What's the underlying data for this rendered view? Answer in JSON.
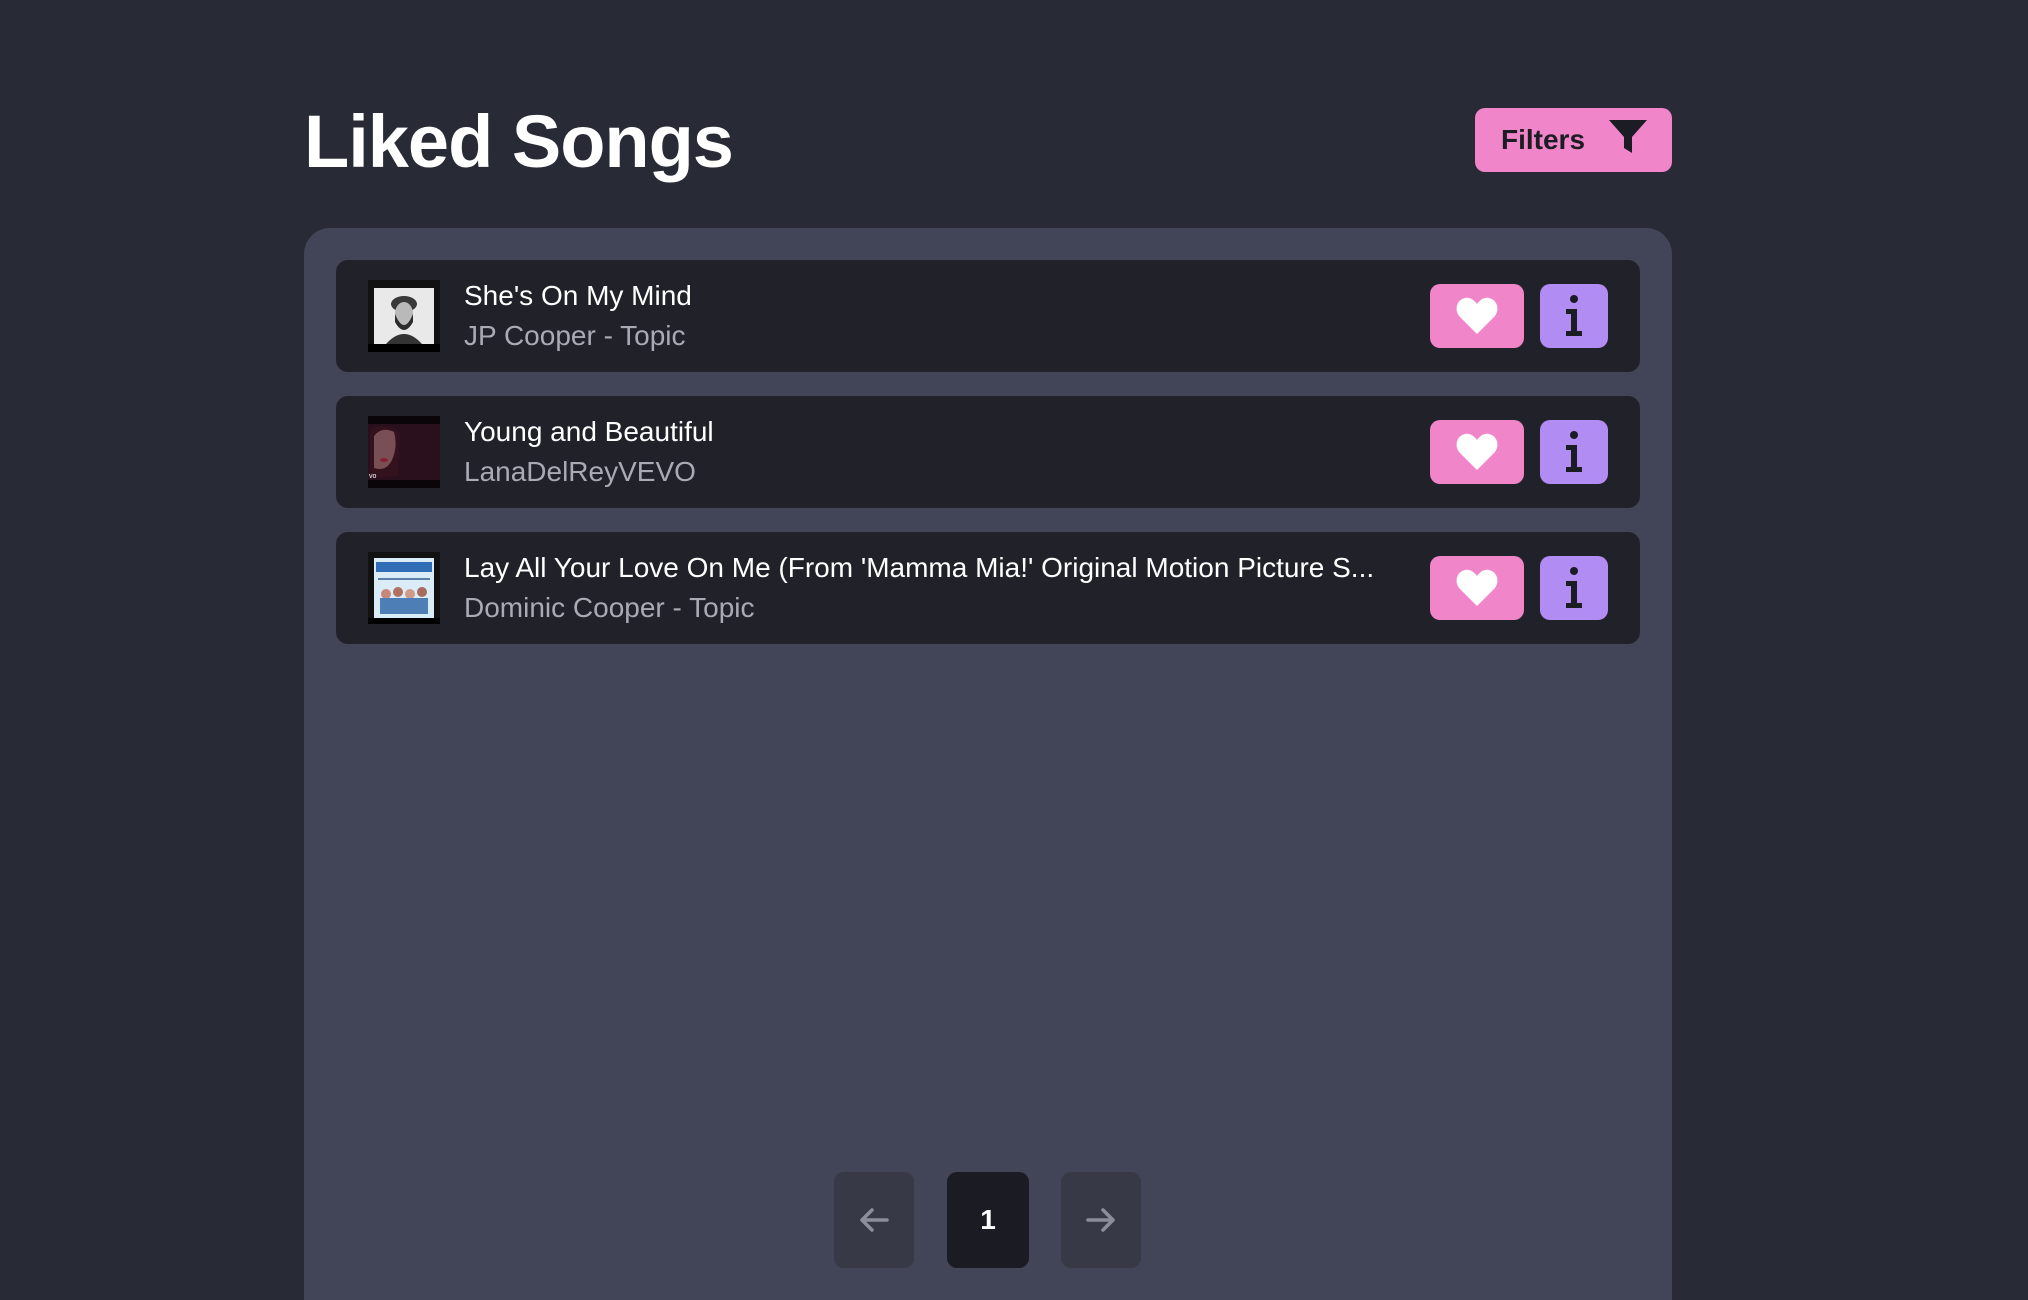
{
  "header": {
    "title": "Liked Songs",
    "filters_label": "Filters"
  },
  "songs": [
    {
      "title": "She's On My Mind",
      "artist": "JP Cooper - Topic",
      "thumbnail": "jp-cooper-portrait"
    },
    {
      "title": "Young and Beautiful",
      "artist": "LanaDelReyVEVO",
      "thumbnail": "lana-del-rey-portrait"
    },
    {
      "title": "Lay All Your Love On Me (From 'Mamma Mia!' Original Motion Picture S...",
      "artist": "Dominic Cooper - Topic",
      "thumbnail": "mamma-mia-cover"
    }
  ],
  "pagination": {
    "current_page": "1"
  },
  "colors": {
    "background": "#282a36",
    "panel": "#424557",
    "row": "#202129",
    "like_button": "#f185c9",
    "info_button": "#b18cf2"
  }
}
